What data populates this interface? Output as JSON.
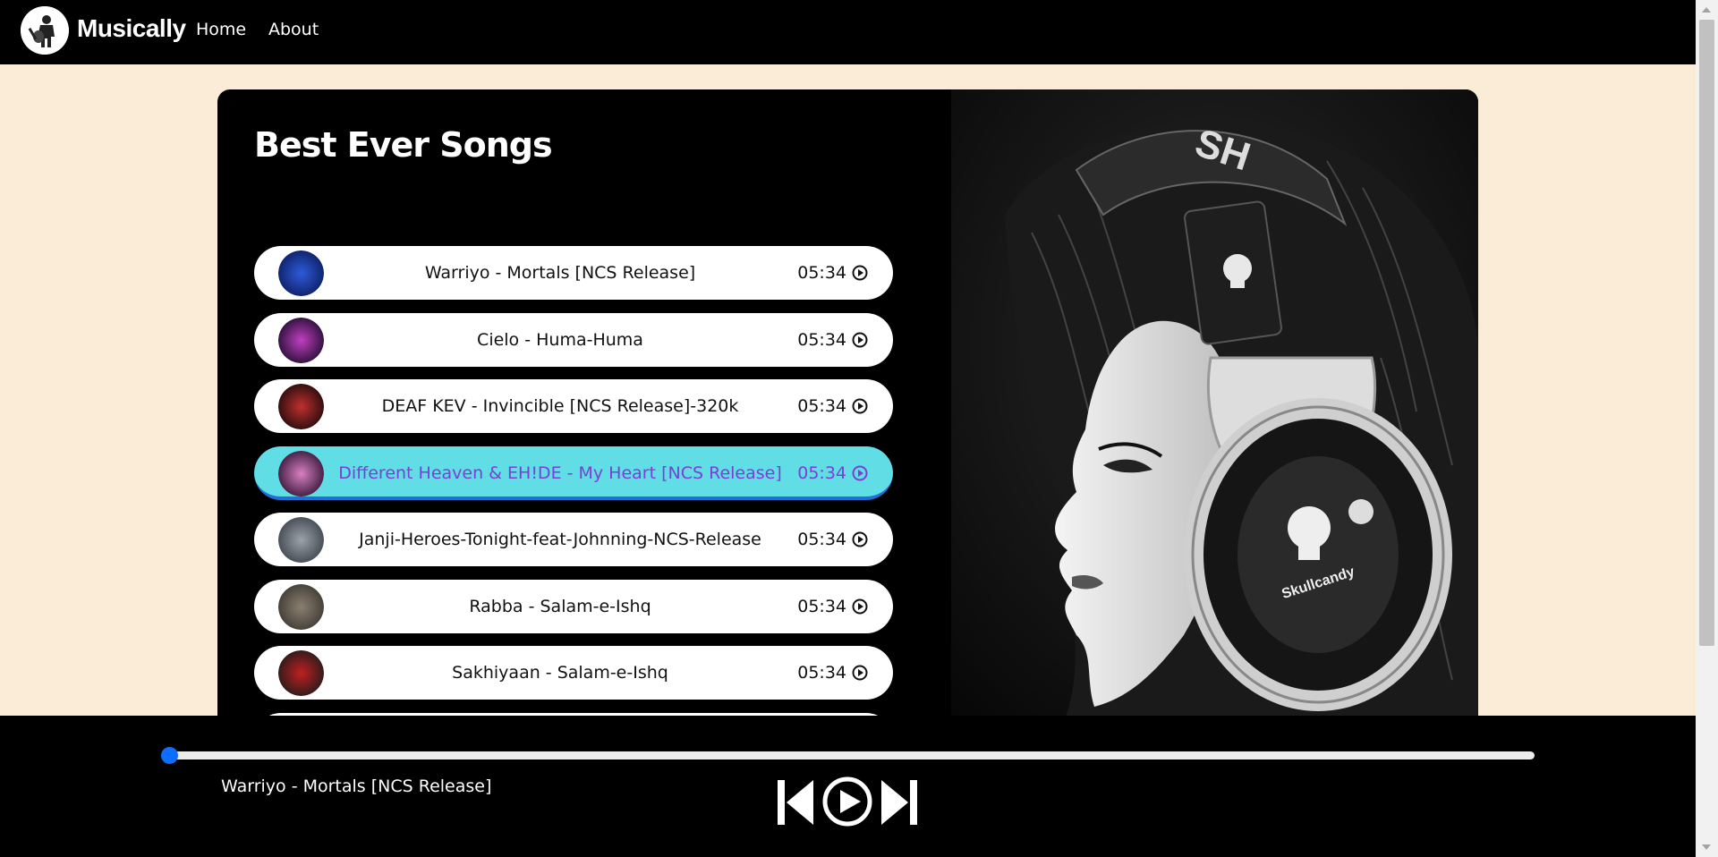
{
  "navbar": {
    "brand": "Musically",
    "links": [
      "Home",
      "About"
    ]
  },
  "main": {
    "title": "Best Ever Songs",
    "songs": [
      {
        "name": "Warriyo - Mortals [NCS Release]",
        "duration": "05:34",
        "active": false
      },
      {
        "name": "Cielo - Huma-Huma",
        "duration": "05:34",
        "active": false
      },
      {
        "name": "DEAF KEV - Invincible [NCS Release]-320k",
        "duration": "05:34",
        "active": false
      },
      {
        "name": "Different Heaven & EH!DE - My Heart [NCS Release]",
        "duration": "05:34",
        "active": true
      },
      {
        "name": "Janji-Heroes-Tonight-feat-Johnning-NCS-Release",
        "duration": "05:34",
        "active": false
      },
      {
        "name": "Rabba - Salam-e-Ishq",
        "duration": "05:34",
        "active": false
      },
      {
        "name": "Sakhiyaan - Salam-e-Ishq",
        "duration": "05:34",
        "active": false
      }
    ]
  },
  "player": {
    "now_playing": "Warriyo - Mortals [NCS Release]",
    "progress": 0,
    "controls": [
      "previous-icon",
      "play-icon",
      "next-icon"
    ]
  },
  "colors": {
    "background": "#fbecd8",
    "active_song_bg": "#61dde6",
    "active_song_text": "#7b3fd4",
    "progress_knob": "#0d6efd"
  }
}
